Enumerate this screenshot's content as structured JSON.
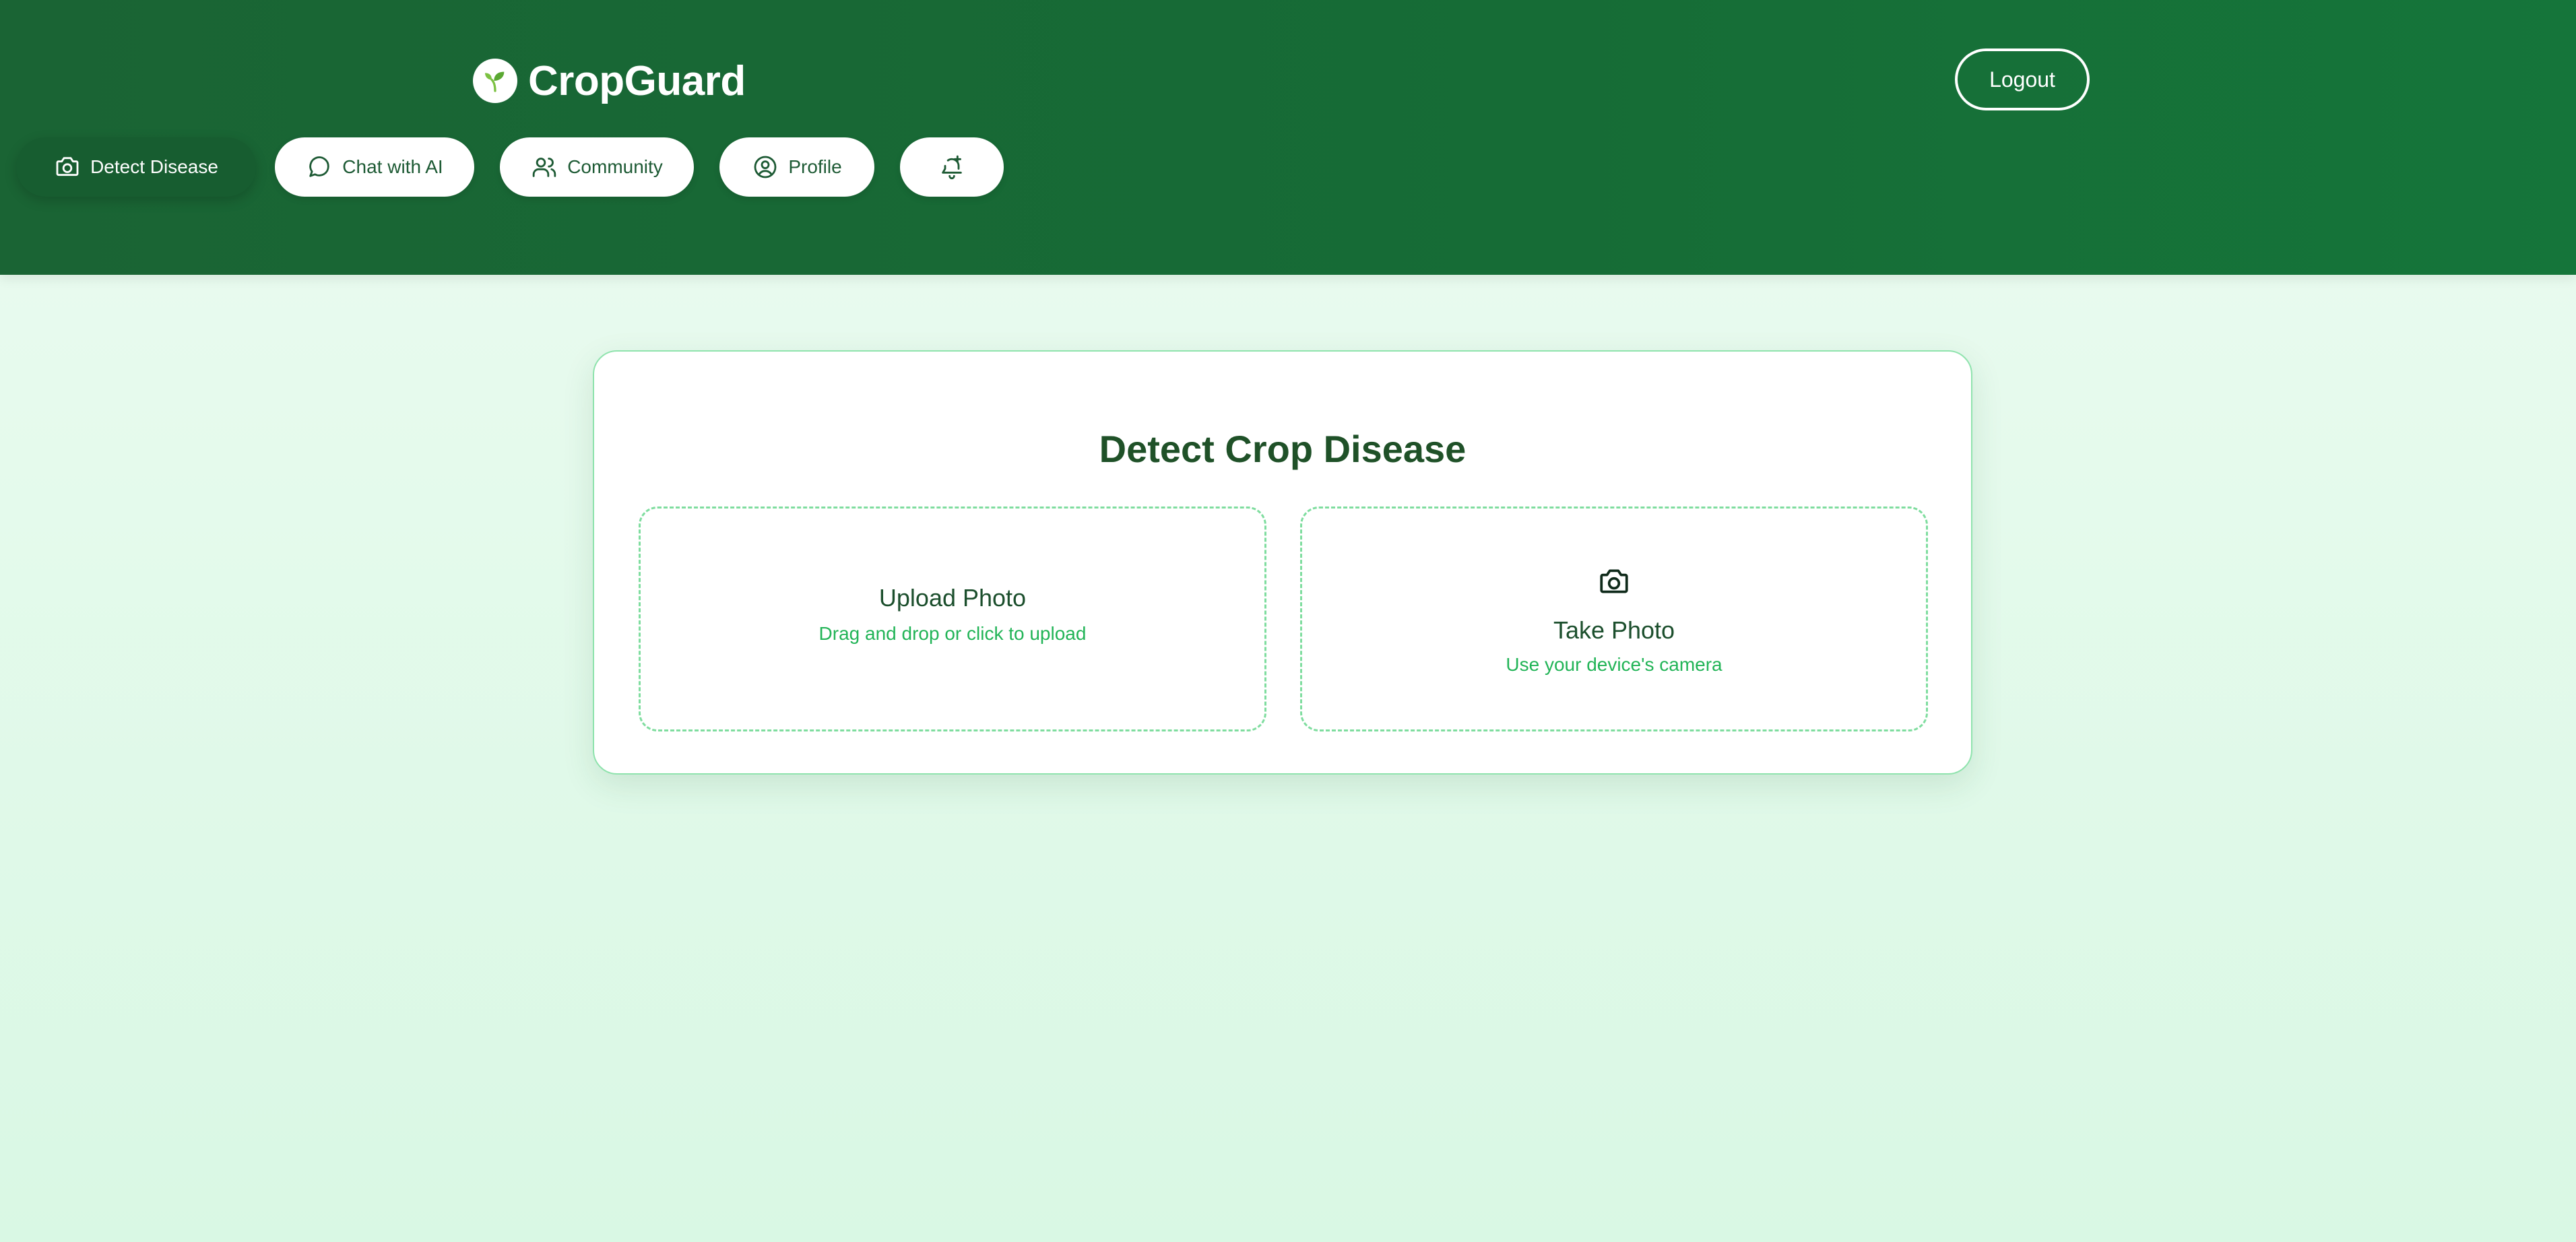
{
  "brand": {
    "name": "CropGuard",
    "logo_icon": "sprout-icon"
  },
  "header": {
    "logout_label": "Logout"
  },
  "nav": {
    "items": [
      {
        "label": "Detect Disease",
        "icon": "camera-icon",
        "active": true
      },
      {
        "label": "Chat with AI",
        "icon": "chat-bubble-icon",
        "active": false
      },
      {
        "label": "Community",
        "icon": "users-icon",
        "active": false
      },
      {
        "label": "Profile",
        "icon": "user-circle-icon",
        "active": false
      },
      {
        "label": "",
        "icon": "bell-plus-icon",
        "active": false
      }
    ]
  },
  "main": {
    "title": "Detect Crop Disease",
    "upload": {
      "title": "Upload Photo",
      "subtitle": "Drag and drop or click to upload"
    },
    "camera": {
      "title": "Take Photo",
      "subtitle": "Use your device's camera",
      "icon": "camera-icon"
    }
  },
  "colors": {
    "header_green": "#1a6434",
    "accent_green": "#22b457",
    "title_green": "#1f5128",
    "border_green": "#8fe3ad",
    "background_mint": "#e3faea"
  }
}
